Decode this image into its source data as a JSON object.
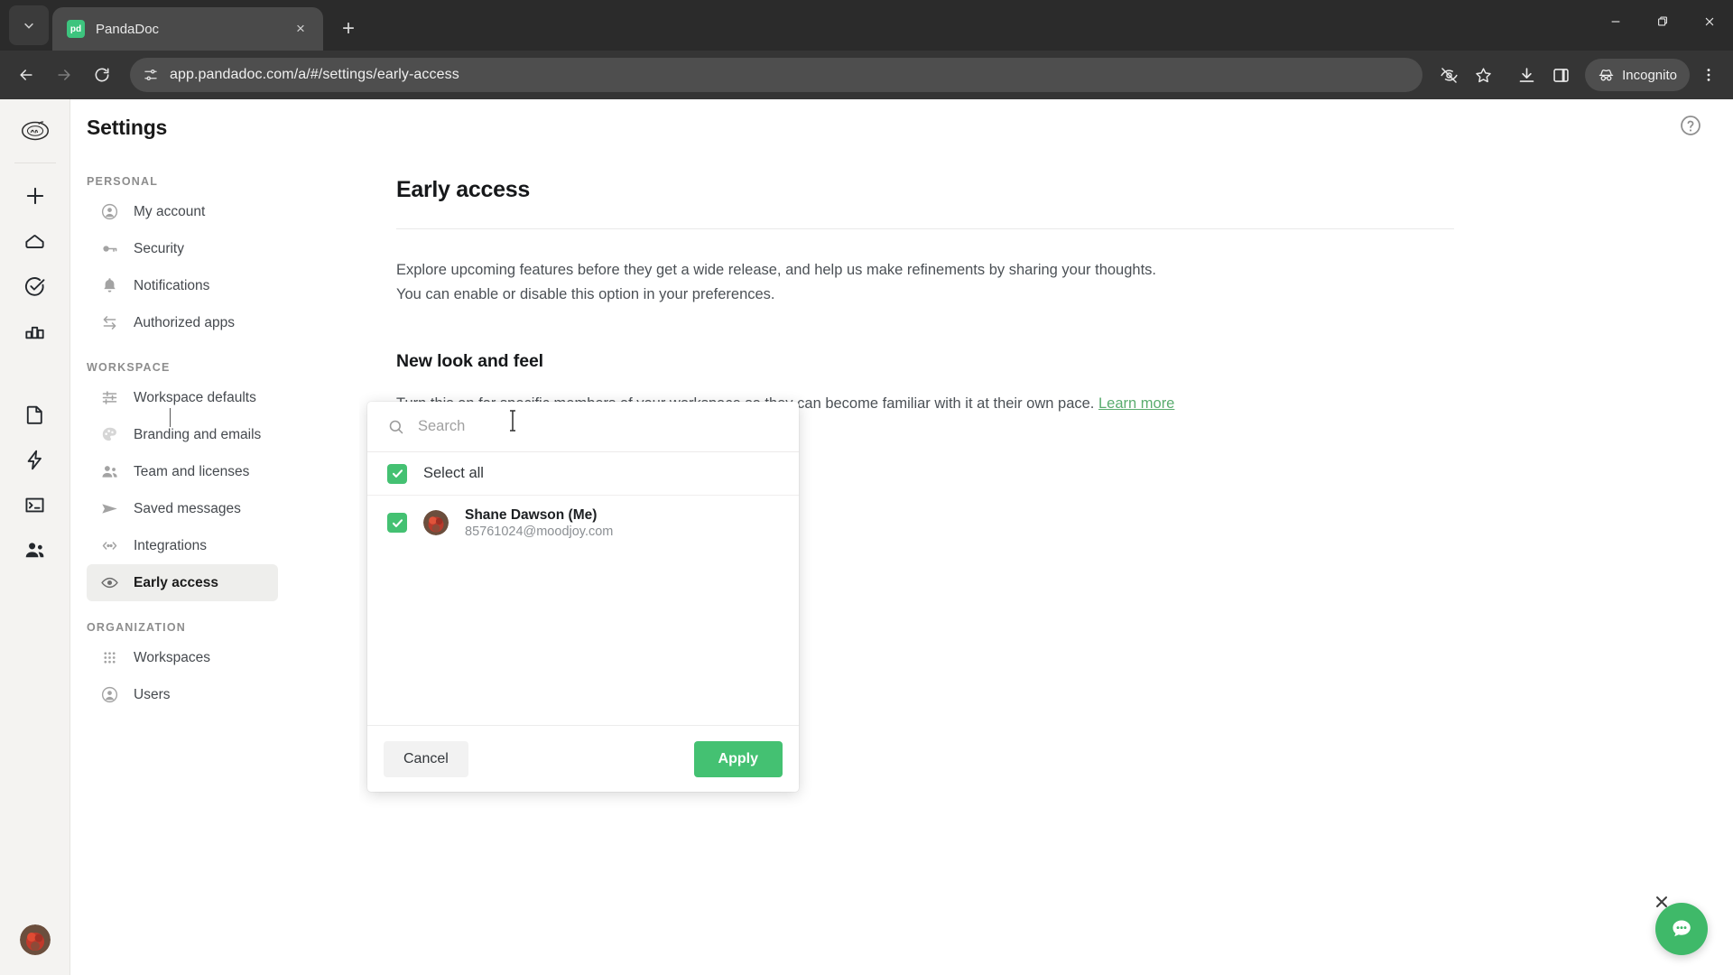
{
  "browser": {
    "tab": {
      "title": "PandaDoc",
      "favicon_label": "pd",
      "favicon_color": "#3dc47e"
    },
    "new_tab_label": "+",
    "close_tab_label": "×",
    "window": {
      "minimize": "—",
      "maximize": "❐",
      "close": "✕"
    },
    "address": "app.pandadoc.com/a/#/settings/early-access",
    "profile_label": "Incognito",
    "icons": {
      "tab_search": "chevron-down-icon",
      "back": "back-arrow-icon",
      "forward": "forward-arrow-icon",
      "reload": "reload-icon",
      "site_info": "site-settings-icon",
      "tracking": "eye-off-icon",
      "bookmark": "star-icon",
      "downloads": "download-icon",
      "side_panel": "side-panel-icon",
      "menu": "three-dot-menu-icon"
    }
  },
  "rail": {
    "logo_alt": "workspace-logo",
    "items": [
      {
        "name": "create-new",
        "icon": "plus-icon"
      },
      {
        "name": "home",
        "icon": "home-icon"
      },
      {
        "name": "tasks",
        "icon": "check-circle-icon"
      },
      {
        "name": "reports",
        "icon": "bar-chart-icon"
      },
      {
        "name": "documents",
        "icon": "document-icon"
      },
      {
        "name": "quick-actions",
        "icon": "lightning-icon"
      },
      {
        "name": "forms",
        "icon": "terminal-icon"
      },
      {
        "name": "contacts",
        "icon": "people-icon"
      }
    ],
    "avatar_alt": "user-avatar"
  },
  "settings": {
    "title": "Settings",
    "groups": [
      {
        "label": "PERSONAL",
        "items": [
          {
            "label": "My account",
            "icon": "person-circle-icon",
            "active": false
          },
          {
            "label": "Security",
            "icon": "key-icon",
            "active": false
          },
          {
            "label": "Notifications",
            "icon": "bell-icon",
            "active": false
          },
          {
            "label": "Authorized apps",
            "icon": "transfer-arrows-icon",
            "active": false
          }
        ]
      },
      {
        "label": "WORKSPACE",
        "items": [
          {
            "label": "Workspace defaults",
            "icon": "sliders-icon",
            "active": false
          },
          {
            "label": "Branding and emails",
            "icon": "palette-icon",
            "active": false
          },
          {
            "label": "Team and licenses",
            "icon": "team-icon",
            "active": false
          },
          {
            "label": "Saved messages",
            "icon": "send-icon",
            "active": false
          },
          {
            "label": "Integrations",
            "icon": "code-brackets-icon",
            "active": false
          },
          {
            "label": "Early access",
            "icon": "eye-icon",
            "active": true
          }
        ]
      },
      {
        "label": "ORGANIZATION",
        "items": [
          {
            "label": "Workspaces",
            "icon": "grid-dots-icon",
            "active": false
          },
          {
            "label": "Users",
            "icon": "person-circle-icon",
            "active": false
          }
        ]
      }
    ]
  },
  "main": {
    "help_icon": "help-circle-icon",
    "page_title": "Early access",
    "intro_line1": "Explore upcoming features before they get a wide release, and help us make refinements by sharing your thoughts.",
    "intro_line2": "You can enable or disable this option in your preferences.",
    "section_title": "New look and feel",
    "section_desc": "Turn this on for specific members of your workspace so they can become familiar with it at their own pace.",
    "learn_more": "Learn more",
    "learn_more_color": "#5aac6e"
  },
  "dropdown": {
    "search": {
      "placeholder": "Search",
      "value": ""
    },
    "select_all": {
      "label": "Select all",
      "checked": true
    },
    "people": [
      {
        "name": "Shane Dawson (Me)",
        "email": "85761024@moodjoy.com",
        "checked": true
      }
    ],
    "cancel_label": "Cancel",
    "apply_label": "Apply",
    "accent_color": "#44c172"
  },
  "chat": {
    "icon": "chat-bubble-icon",
    "close_icon": "close-icon",
    "color": "#3fb969"
  }
}
